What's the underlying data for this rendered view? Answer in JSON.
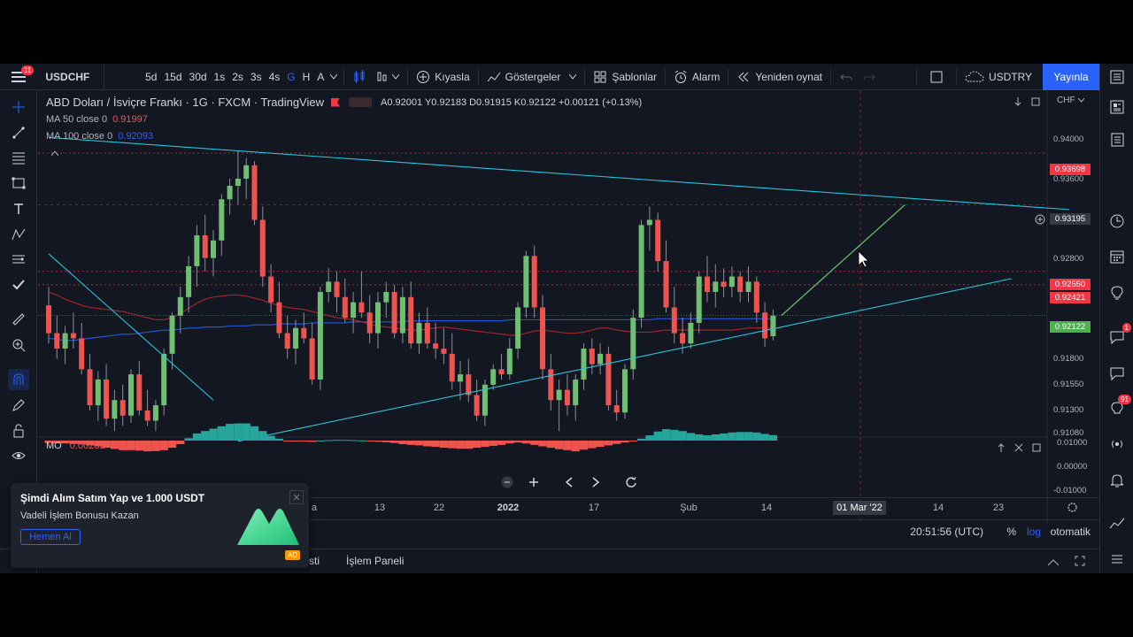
{
  "toolbar": {
    "notifications": "11",
    "symbol": "USDCHF",
    "intervals": [
      "5d",
      "15d",
      "30d",
      "1s",
      "2s",
      "3s",
      "4s",
      "G",
      "H",
      "A"
    ],
    "active_interval": "G",
    "compare": "Kıyasla",
    "indicators": "Göstergeler",
    "templates": "Şablonlar",
    "alert": "Alarm",
    "replay": "Yeniden oynat",
    "layout_symbol": "USDTRY",
    "publish": "Yayınla"
  },
  "legend": {
    "title": "ABD Doları / İsviçre Frankı · 1G · FXCM · TradingView",
    "ohlc": "A0.92001 Y0.92183 D0.91915 K0.92122 +0.00121 (+0.13%)",
    "ma50_label": "MA 50 close 0",
    "ma50_value": "0.91997",
    "ma100_label": "MA 100 close 0",
    "ma100_value": "0.92093",
    "currency": "CHF"
  },
  "price_axis": {
    "labels": [
      "0.94000",
      "0.93600",
      "0.92800",
      "0.91800",
      "0.91550",
      "0.91300",
      "0.91080"
    ],
    "tags": {
      "top_red": "0.93698",
      "crosshair": "0.93195",
      "red_1": "0.92550",
      "red_2": "0.92421",
      "last": "0.92122"
    }
  },
  "oscillator": {
    "name": "MO",
    "value": "0.00232",
    "axis": [
      "0.01000",
      "0.00000",
      "-0.01000"
    ]
  },
  "time_axis": {
    "labels": [
      "a",
      "13",
      "22",
      "2022",
      "17",
      "Şub",
      "14",
      "14",
      "23"
    ],
    "crosshair": "01 Mar '22"
  },
  "status": {
    "clock": "20:51:56 (UTC)",
    "percent": "%",
    "log": "log",
    "auto": "otomatik"
  },
  "bottom": {
    "tab1": "sti",
    "tab2": "İşlem Paneli"
  },
  "ad": {
    "title": "Şimdi Alım Satım Yap ve 1.000 USDT",
    "subtitle": "Vadeli İşlem Bonusu Kazan",
    "button": "Hemen Al",
    "tag": "AD"
  },
  "right_badges": {
    "chat": "1",
    "ideas": "91"
  },
  "chart_data": {
    "type": "candlestick",
    "symbol": "USDCHF",
    "interval": "1G",
    "ylim": [
      0.9095,
      0.943
    ],
    "up_color": "#26a69a",
    "down_color": "#ef5350",
    "candles": [
      [
        0.9222,
        0.924,
        0.9185,
        0.9195
      ],
      [
        0.9195,
        0.9212,
        0.917,
        0.918
      ],
      [
        0.918,
        0.9202,
        0.9165,
        0.9195
      ],
      [
        0.9195,
        0.9215,
        0.918,
        0.919
      ],
      [
        0.919,
        0.9205,
        0.9155,
        0.916
      ],
      [
        0.916,
        0.9175,
        0.912,
        0.9125
      ],
      [
        0.9125,
        0.9158,
        0.911,
        0.915
      ],
      [
        0.915,
        0.9165,
        0.9105,
        0.9112
      ],
      [
        0.9112,
        0.914,
        0.91,
        0.913
      ],
      [
        0.913,
        0.9145,
        0.9105,
        0.9115
      ],
      [
        0.9115,
        0.916,
        0.9108,
        0.9155
      ],
      [
        0.9155,
        0.9168,
        0.9115,
        0.912
      ],
      [
        0.912,
        0.914,
        0.9105,
        0.911
      ],
      [
        0.911,
        0.913,
        0.91,
        0.9125
      ],
      [
        0.9125,
        0.918,
        0.9115,
        0.9175
      ],
      [
        0.9175,
        0.9215,
        0.916,
        0.9212
      ],
      [
        0.9212,
        0.924,
        0.9195,
        0.923
      ],
      [
        0.923,
        0.927,
        0.9215,
        0.926
      ],
      [
        0.926,
        0.93,
        0.924,
        0.929
      ],
      [
        0.929,
        0.931,
        0.9255,
        0.9268
      ],
      [
        0.9268,
        0.9295,
        0.925,
        0.9285
      ],
      [
        0.9285,
        0.933,
        0.927,
        0.9325
      ],
      [
        0.9325,
        0.9345,
        0.931,
        0.9338
      ],
      [
        0.9338,
        0.9372,
        0.932,
        0.9345
      ],
      [
        0.9345,
        0.9365,
        0.9325,
        0.9358
      ],
      [
        0.9358,
        0.9362,
        0.93,
        0.9305
      ],
      [
        0.9305,
        0.9318,
        0.924,
        0.925
      ],
      [
        0.925,
        0.9262,
        0.9215,
        0.9225
      ],
      [
        0.9225,
        0.9245,
        0.919,
        0.9195
      ],
      [
        0.9195,
        0.9212,
        0.917,
        0.918
      ],
      [
        0.918,
        0.9208,
        0.9165,
        0.92
      ],
      [
        0.92,
        0.9215,
        0.9185,
        0.919
      ],
      [
        0.919,
        0.9205,
        0.9145,
        0.915
      ],
      [
        0.915,
        0.924,
        0.914,
        0.9235
      ],
      [
        0.9235,
        0.9258,
        0.9225,
        0.9245
      ],
      [
        0.9245,
        0.9255,
        0.9215,
        0.923
      ],
      [
        0.923,
        0.9248,
        0.9205,
        0.921
      ],
      [
        0.921,
        0.9235,
        0.9195,
        0.9225
      ],
      [
        0.9225,
        0.9255,
        0.921,
        0.9215
      ],
      [
        0.9215,
        0.9232,
        0.9185,
        0.9195
      ],
      [
        0.9195,
        0.9235,
        0.918,
        0.9225
      ],
      [
        0.9225,
        0.9245,
        0.921,
        0.9235
      ],
      [
        0.9235,
        0.9242,
        0.919,
        0.9195
      ],
      [
        0.9195,
        0.924,
        0.9185,
        0.923
      ],
      [
        0.923,
        0.9245,
        0.918,
        0.9185
      ],
      [
        0.9185,
        0.9215,
        0.9175,
        0.9205
      ],
      [
        0.9205,
        0.922,
        0.918,
        0.9185
      ],
      [
        0.9185,
        0.9205,
        0.917,
        0.918
      ],
      [
        0.918,
        0.92,
        0.9165,
        0.9175
      ],
      [
        0.9175,
        0.9195,
        0.914,
        0.9148
      ],
      [
        0.9148,
        0.9168,
        0.913,
        0.9155
      ],
      [
        0.9155,
        0.917,
        0.9128,
        0.9135
      ],
      [
        0.9135,
        0.915,
        0.911,
        0.9115
      ],
      [
        0.9115,
        0.915,
        0.9105,
        0.9145
      ],
      [
        0.9145,
        0.9165,
        0.914,
        0.916
      ],
      [
        0.916,
        0.9175,
        0.915,
        0.9155
      ],
      [
        0.9155,
        0.919,
        0.915,
        0.918
      ],
      [
        0.918,
        0.9225,
        0.917,
        0.922
      ],
      [
        0.922,
        0.9275,
        0.921,
        0.927
      ],
      [
        0.927,
        0.928,
        0.921,
        0.922
      ],
      [
        0.922,
        0.9232,
        0.915,
        0.916
      ],
      [
        0.916,
        0.9175,
        0.912,
        0.913
      ],
      [
        0.913,
        0.915,
        0.91,
        0.914
      ],
      [
        0.914,
        0.9155,
        0.9115,
        0.9125
      ],
      [
        0.9125,
        0.9155,
        0.911,
        0.915
      ],
      [
        0.915,
        0.9185,
        0.914,
        0.918
      ],
      [
        0.918,
        0.919,
        0.9155,
        0.9165
      ],
      [
        0.9165,
        0.9185,
        0.9155,
        0.9175
      ],
      [
        0.9175,
        0.9182,
        0.912,
        0.9125
      ],
      [
        0.9125,
        0.914,
        0.911,
        0.9118
      ],
      [
        0.9118,
        0.9165,
        0.9112,
        0.916
      ],
      [
        0.916,
        0.9218,
        0.915,
        0.921
      ],
      [
        0.921,
        0.9305,
        0.92,
        0.93
      ],
      [
        0.93,
        0.9318,
        0.9275,
        0.9305
      ],
      [
        0.9305,
        0.9312,
        0.9255,
        0.9265
      ],
      [
        0.9265,
        0.9285,
        0.9215,
        0.922
      ],
      [
        0.922,
        0.924,
        0.9185,
        0.9195
      ],
      [
        0.9195,
        0.921,
        0.9175,
        0.9185
      ],
      [
        0.9185,
        0.9215,
        0.918,
        0.9205
      ],
      [
        0.9205,
        0.9255,
        0.9195,
        0.925
      ],
      [
        0.925,
        0.927,
        0.9225,
        0.9235
      ],
      [
        0.9235,
        0.9262,
        0.922,
        0.9245
      ],
      [
        0.9245,
        0.9258,
        0.923,
        0.924
      ],
      [
        0.924,
        0.926,
        0.923,
        0.925
      ],
      [
        0.925,
        0.9255,
        0.9225,
        0.9235
      ],
      [
        0.9235,
        0.926,
        0.9225,
        0.9245
      ],
      [
        0.9245,
        0.925,
        0.9205,
        0.9215
      ],
      [
        0.9215,
        0.9225,
        0.9182,
        0.919
      ],
      [
        0.9192,
        0.9218,
        0.9188,
        0.9212
      ]
    ],
    "ma50": [
      0.9235,
      0.9232,
      0.9228,
      0.9225,
      0.9222,
      0.922,
      0.9219,
      0.9218,
      0.9217,
      0.9216,
      0.9214,
      0.9212,
      0.921,
      0.9208,
      0.9208,
      0.921,
      0.9214,
      0.9219,
      0.9224,
      0.9228,
      0.923,
      0.9231,
      0.9232,
      0.9232,
      0.9231,
      0.9229,
      0.9227,
      0.9224,
      0.9222,
      0.922,
      0.9219,
      0.9218,
      0.9216,
      0.9214,
      0.9212,
      0.921,
      0.9209,
      0.9208,
      0.9206,
      0.9204,
      0.9202,
      0.9201,
      0.92,
      0.9199,
      0.9198,
      0.9198,
      0.9199,
      0.92,
      0.9201,
      0.92,
      0.9199,
      0.9198,
      0.9197,
      0.9196,
      0.9195,
      0.9194,
      0.9193,
      0.9193,
      0.9195,
      0.9197,
      0.9198,
      0.9197,
      0.9196,
      0.9195,
      0.9195,
      0.9196,
      0.9198,
      0.92,
      0.92,
      0.9198,
      0.9197,
      0.9196,
      0.9196,
      0.9196,
      0.9197,
      0.9198,
      0.9198,
      0.9198,
      0.9198,
      0.9198,
      0.9198,
      0.9198,
      0.9198,
      0.9198,
      0.9199,
      0.92,
      0.92,
      0.92,
      0.92
    ],
    "ma100": [
      0.919,
      0.9189,
      0.9188,
      0.9188,
      0.9189,
      0.919,
      0.9191,
      0.9192,
      0.9193,
      0.9194,
      0.9194,
      0.9195,
      0.9196,
      0.9197,
      0.9198,
      0.9198,
      0.9199,
      0.92,
      0.92,
      0.9201,
      0.9201,
      0.9201,
      0.9202,
      0.9202,
      0.9202,
      0.9203,
      0.9203,
      0.9203,
      0.9204,
      0.9204,
      0.9204,
      0.9204,
      0.9205,
      0.9205,
      0.9205,
      0.9205,
      0.9205,
      0.9206,
      0.9206,
      0.9206,
      0.9206,
      0.9206,
      0.9206,
      0.9206,
      0.9207,
      0.9207,
      0.9207,
      0.9207,
      0.9207,
      0.9207,
      0.9207,
      0.9207,
      0.9207,
      0.9207,
      0.9207,
      0.9207,
      0.9208,
      0.9208,
      0.9208,
      0.9208,
      0.9208,
      0.9208,
      0.9208,
      0.9208,
      0.9208,
      0.9208,
      0.9208,
      0.9208,
      0.9208,
      0.9208,
      0.9208,
      0.9208,
      0.9208,
      0.9208,
      0.9209,
      0.9209,
      0.9209,
      0.9209,
      0.9209,
      0.9209,
      0.9209,
      0.9209,
      0.9209,
      0.9209,
      0.9209,
      0.9209,
      0.9209,
      0.9209,
      0.9209
    ],
    "mo": [
      -0.001,
      -0.0011,
      -0.0012,
      -0.0014,
      -0.0016,
      -0.002,
      -0.0024,
      -0.003,
      -0.0035,
      -0.004,
      -0.004,
      -0.0042,
      -0.0045,
      -0.0044,
      -0.004,
      -0.003,
      -0.0015,
      0.001,
      0.003,
      0.004,
      0.005,
      0.006,
      0.007,
      0.0072,
      0.0072,
      0.006,
      0.004,
      0.002,
      0.0008,
      -0.0002,
      -0.0004,
      -0.0002,
      -0.0005,
      0.0,
      0.0002,
      0.0003,
      0.0003,
      0.0002,
      0.0001,
      -0.0002,
      -0.0005,
      -0.0007,
      -0.001,
      -0.0015,
      -0.0018,
      -0.002,
      -0.0024,
      -0.0026,
      -0.003,
      -0.0032,
      -0.0034,
      -0.0034,
      -0.003,
      -0.0026,
      -0.0022,
      -0.0018,
      -0.0012,
      -0.0008,
      -0.0012,
      -0.0018,
      -0.0024,
      -0.003,
      -0.0036,
      -0.004,
      -0.0045,
      -0.0038,
      -0.0032,
      -0.0026,
      -0.002,
      -0.0014,
      -0.0008,
      -0.0002,
      0.0008,
      0.0022,
      0.0038,
      0.0048,
      0.0045,
      0.004,
      0.0032,
      0.0026,
      0.0022,
      0.0026,
      0.003,
      0.0034,
      0.0036,
      0.0036,
      0.0034,
      0.0028,
      0.0023
    ],
    "hlines_red": [
      0.93698,
      0.9255,
      0.92421
    ],
    "hline_crosshair": 0.93195,
    "last_price": 0.92122,
    "trendlines": [
      {
        "from": [
          0,
          0.9385
        ],
        "to": [
          124,
          0.9315
        ]
      },
      {
        "from": [
          23,
          0.909
        ],
        "to": [
          117,
          0.9248
        ]
      },
      {
        "from": [
          0,
          0.9272
        ],
        "to": [
          20,
          0.913
        ]
      }
    ],
    "projection": {
      "from": [
        89,
        0.9212
      ],
      "to": [
        104,
        0.93195
      ]
    }
  }
}
